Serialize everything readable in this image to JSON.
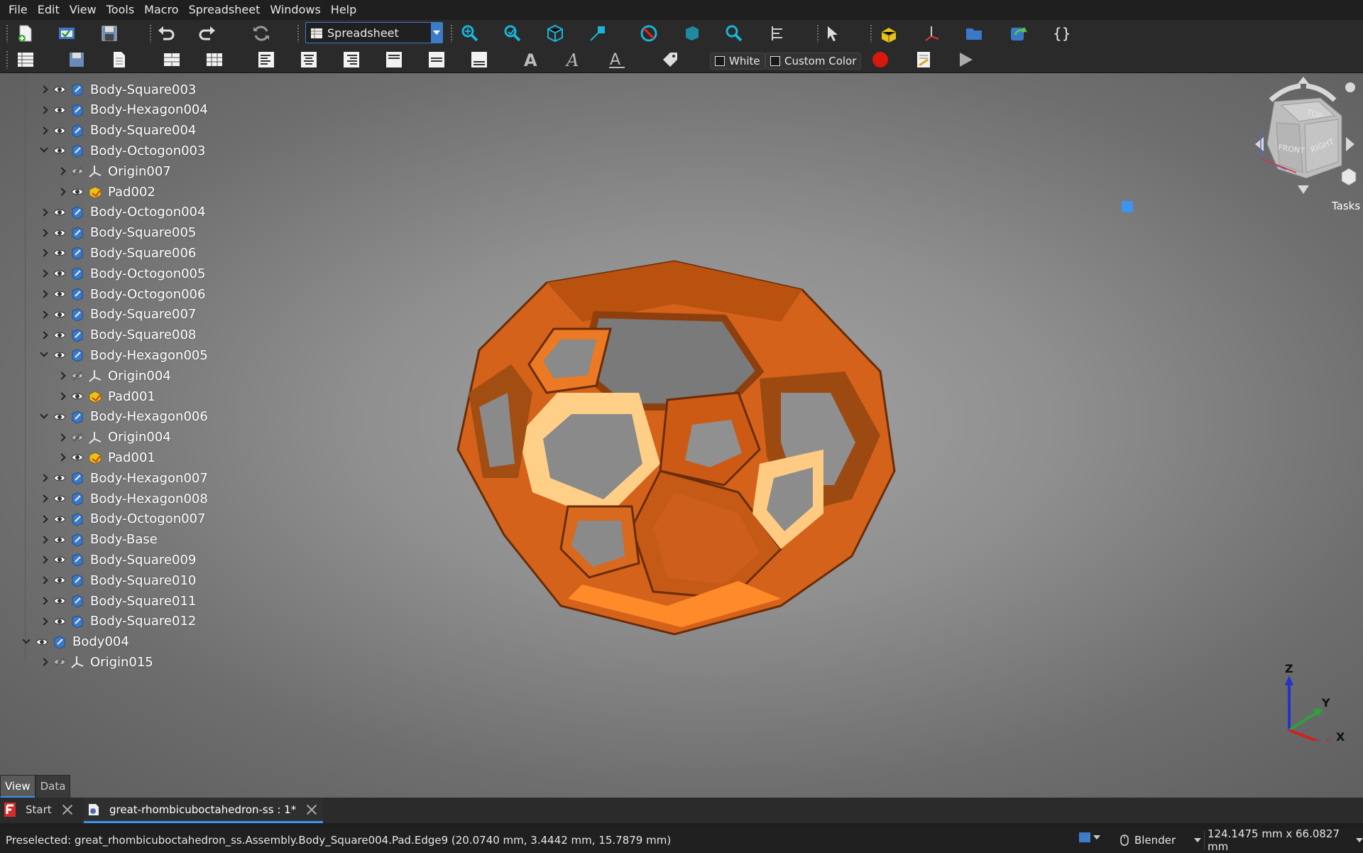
{
  "menu": [
    "File",
    "Edit",
    "View",
    "Tools",
    "Macro",
    "Spreadsheet",
    "Windows",
    "Help"
  ],
  "toolbar": {
    "workbench": "Spreadsheet",
    "checkbox_white": "White",
    "checkbox_custom": "Custom Color"
  },
  "tree": [
    {
      "label": "Body-Square003",
      "level": 1,
      "state": "closed",
      "icon": "body-icon"
    },
    {
      "label": "Body-Hexagon004",
      "level": 1,
      "state": "closed",
      "icon": "body-icon"
    },
    {
      "label": "Body-Square004",
      "level": 1,
      "state": "closed",
      "icon": "body-icon"
    },
    {
      "label": "Body-Octogon003",
      "level": 1,
      "state": "open",
      "icon": "body-icon"
    },
    {
      "label": "Origin007",
      "level": 2,
      "state": "closed",
      "icon": "origin-icon"
    },
    {
      "label": "Pad002",
      "level": 2,
      "state": "closed",
      "icon": "pad-icon"
    },
    {
      "label": "Body-Octogon004",
      "level": 1,
      "state": "closed",
      "icon": "body-icon"
    },
    {
      "label": "Body-Square005",
      "level": 1,
      "state": "closed",
      "icon": "body-icon"
    },
    {
      "label": "Body-Square006",
      "level": 1,
      "state": "closed",
      "icon": "body-icon"
    },
    {
      "label": "Body-Octogon005",
      "level": 1,
      "state": "closed",
      "icon": "body-icon"
    },
    {
      "label": "Body-Octogon006",
      "level": 1,
      "state": "closed",
      "icon": "body-icon"
    },
    {
      "label": "Body-Square007",
      "level": 1,
      "state": "closed",
      "icon": "body-icon"
    },
    {
      "label": "Body-Square008",
      "level": 1,
      "state": "closed",
      "icon": "body-icon"
    },
    {
      "label": "Body-Hexagon005",
      "level": 1,
      "state": "open",
      "icon": "body-icon"
    },
    {
      "label": "Origin004",
      "level": 2,
      "state": "closed",
      "icon": "origin-icon"
    },
    {
      "label": "Pad001",
      "level": 2,
      "state": "closed",
      "icon": "pad-icon"
    },
    {
      "label": "Body-Hexagon006",
      "level": 1,
      "state": "open",
      "icon": "body-icon"
    },
    {
      "label": "Origin004",
      "level": 2,
      "state": "closed",
      "icon": "origin-icon"
    },
    {
      "label": "Pad001",
      "level": 2,
      "state": "closed",
      "icon": "pad-icon"
    },
    {
      "label": "Body-Hexagon007",
      "level": 1,
      "state": "closed",
      "icon": "body-icon"
    },
    {
      "label": "Body-Hexagon008",
      "level": 1,
      "state": "closed",
      "icon": "body-icon"
    },
    {
      "label": "Body-Octogon007",
      "level": 1,
      "state": "closed",
      "icon": "body-icon"
    },
    {
      "label": "Body-Base",
      "level": 1,
      "state": "closed",
      "icon": "body-icon"
    },
    {
      "label": "Body-Square009",
      "level": 1,
      "state": "closed",
      "icon": "body-icon"
    },
    {
      "label": "Body-Square010",
      "level": 1,
      "state": "closed",
      "icon": "body-icon"
    },
    {
      "label": "Body-Square011",
      "level": 1,
      "state": "closed",
      "icon": "body-icon"
    },
    {
      "label": "Body-Square012",
      "level": 1,
      "state": "closed",
      "icon": "body-icon"
    },
    {
      "label": "Body004",
      "level": 0,
      "state": "open",
      "icon": "body-icon"
    },
    {
      "label": "Origin015",
      "level": 1,
      "state": "closed",
      "icon": "origin-icon"
    }
  ],
  "navcube": {
    "top": "TOP",
    "front": "FRONT",
    "right": "RIGHT"
  },
  "tasks_label": "Tasks",
  "axes": {
    "x": "X",
    "y": "Y",
    "z": "Z"
  },
  "panel_tabs": [
    "View",
    "Data"
  ],
  "doc_tabs": {
    "start": "Start",
    "document": "great-rhombicuboctahedron-ss : 1*"
  },
  "status": {
    "text": "Preselected: great_rhombicuboctahedron_ss.Assembly.Body_Square004.Pad.Edge9 (20.0740 mm, 3.4442 mm, 15.7879 mm)",
    "nav_style": "Blender",
    "dimensions": "124.1475 mm x 66.0827 mm"
  },
  "colors": {
    "accent": "#3d93f0",
    "model": "#e06a1a",
    "model_dark": "#9c4a12",
    "model_light": "#ffd08a"
  }
}
